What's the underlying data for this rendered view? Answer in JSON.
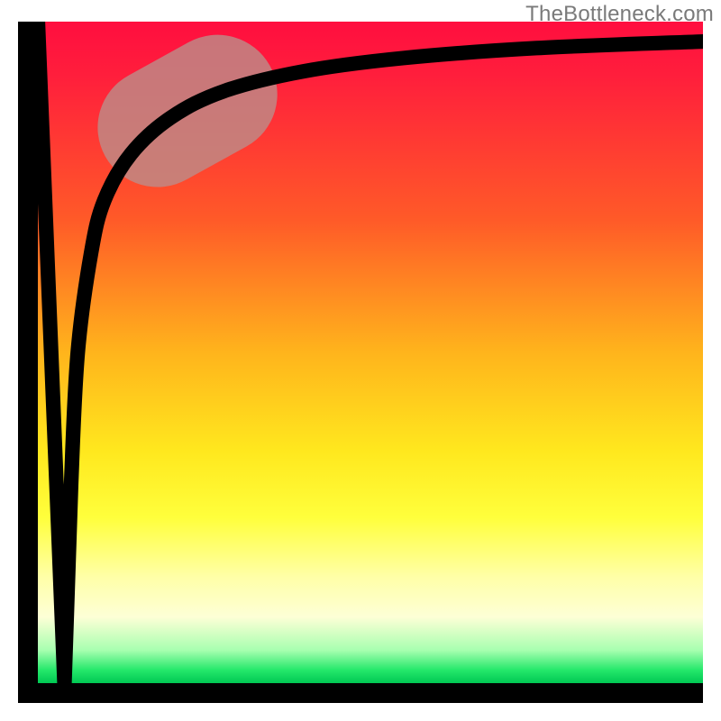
{
  "watermark": "TheBottleneck.com",
  "chart_data": {
    "type": "line",
    "title": "",
    "xlabel": "",
    "ylabel": "",
    "x_range": [
      0,
      100
    ],
    "y_range": [
      0,
      100
    ],
    "curve": [
      {
        "x": 0.0,
        "y": 100.0
      },
      {
        "x": 4.0,
        "y": 0.0
      },
      {
        "x": 4.2,
        "y": 5.0
      },
      {
        "x": 5.0,
        "y": 30.0
      },
      {
        "x": 6.0,
        "y": 50.0
      },
      {
        "x": 8.0,
        "y": 65.0
      },
      {
        "x": 10.0,
        "y": 73.0
      },
      {
        "x": 14.0,
        "y": 80.0
      },
      {
        "x": 20.0,
        "y": 85.5
      },
      {
        "x": 28.0,
        "y": 89.5
      },
      {
        "x": 40.0,
        "y": 92.5
      },
      {
        "x": 55.0,
        "y": 94.5
      },
      {
        "x": 75.0,
        "y": 96.0
      },
      {
        "x": 100.0,
        "y": 97.0
      }
    ],
    "highlight_segment": {
      "x0": 18.0,
      "y0": 84.0,
      "x1": 27.0,
      "y1": 89.0
    },
    "gradient_stops": [
      {
        "pos": 0.0,
        "color": "#ff0e3f"
      },
      {
        "pos": 0.3,
        "color": "#ff5a28"
      },
      {
        "pos": 0.5,
        "color": "#ffb41c"
      },
      {
        "pos": 0.75,
        "color": "#ffff3c"
      },
      {
        "pos": 0.95,
        "color": "#a8ffb0"
      },
      {
        "pos": 1.0,
        "color": "#00c853"
      }
    ]
  }
}
